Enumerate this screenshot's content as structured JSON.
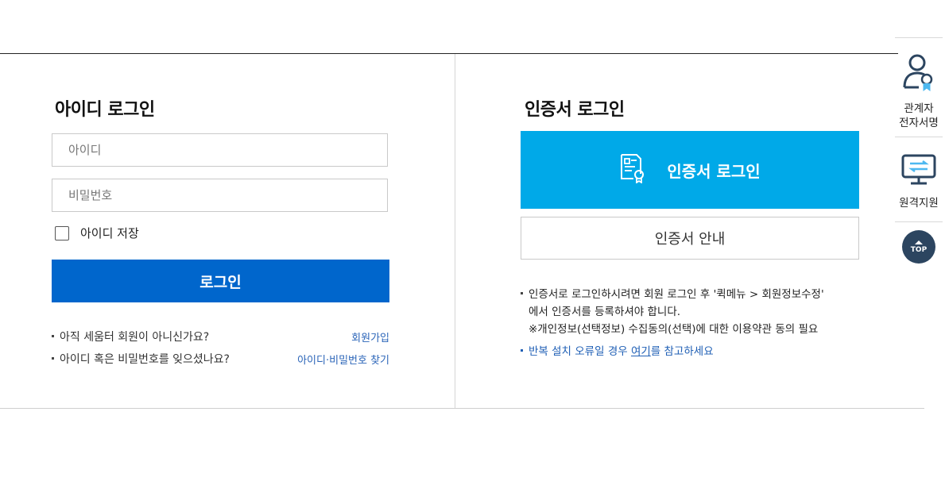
{
  "id_login": {
    "title": "아이디 로그인",
    "id_placeholder": "아이디",
    "pw_placeholder": "비밀번호",
    "remember_label": "아이디 저장",
    "login_label": "로그인",
    "help": [
      {
        "text": "아직 세움터 회원이 아니신가요?",
        "link": "회원가입"
      },
      {
        "text": "아이디 혹은 비밀번호를 잊으셨나요?",
        "link": "아이디·비밀번호 찾기"
      }
    ]
  },
  "cert_login": {
    "title": "인증서 로그인",
    "button_label": "인증서 로그인",
    "guide_label": "인증서 안내",
    "notice_line1": "인증서로 로그인하시려면 회원 로그인 후 '퀵메뉴 > 회원정보수정'",
    "notice_line2": "에서 인증서를 등록하셔야 합니다.",
    "notice_line3": "※개인정보(선택정보) 수집동의(선택)에 대한 이용약관 동의 필요",
    "repeat_prefix": "반복 설치 오류일 경우 ",
    "repeat_link": "여기",
    "repeat_suffix": "를 참고하세요"
  },
  "side_menu": {
    "item1_line1": "관계자",
    "item1_line2": "전자서명",
    "item2": "원격지원",
    "top": "TOP"
  },
  "colors": {
    "login_button": "#0066cc",
    "cert_button": "#00a9e8",
    "link": "#2a64b8",
    "top_button": "#2c4560"
  }
}
